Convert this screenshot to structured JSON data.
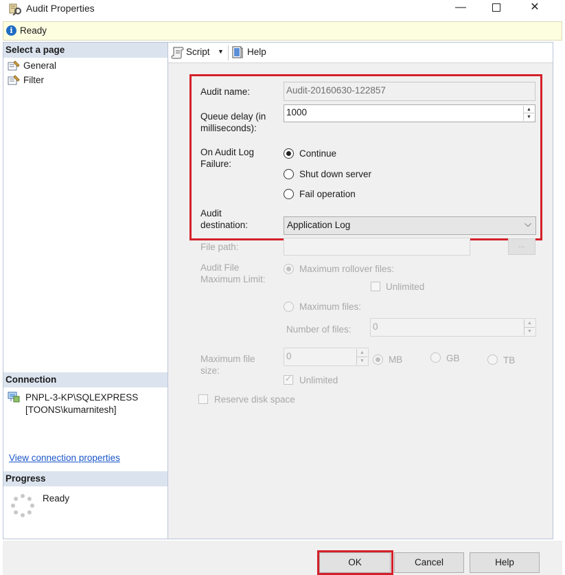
{
  "window": {
    "title": "Audit Properties",
    "minimize_glyph": "—",
    "close_glyph": "✕"
  },
  "status": {
    "icon": "info-icon",
    "text": "Ready"
  },
  "left_pane": {
    "select_page_header": "Select a page",
    "pages": [
      {
        "label": "General",
        "icon": "wrench-page-icon"
      },
      {
        "label": "Filter",
        "icon": "wrench-page-icon"
      }
    ],
    "connection_header": "Connection",
    "connection_server": "PNPL-3-KP\\SQLEXPRESS",
    "connection_user": "[TOONS\\kumarnitesh]",
    "view_connection_link": "View connection properties",
    "progress_header": "Progress",
    "progress_text": "Ready"
  },
  "toolbar": {
    "script_label": "Script",
    "help_label": "Help",
    "caret_glyph": "▼"
  },
  "form": {
    "audit_name_label": "Audit name:",
    "audit_name_value": "Audit-20160630-122857",
    "queue_delay_label_1": "Queue delay (in",
    "queue_delay_label_2": "milliseconds):",
    "queue_delay_value": "1000",
    "on_failure_label_1": "On Audit Log",
    "on_failure_label_2": "Failure:",
    "on_failure_options": [
      {
        "label": "Continue",
        "selected": true
      },
      {
        "label": "Shut down server",
        "selected": false
      },
      {
        "label": "Fail operation",
        "selected": false
      }
    ],
    "destination_label_1": "Audit",
    "destination_label_2": "destination:",
    "destination_value": "Application Log",
    "file_path_label": "File path:",
    "file_path_value": "",
    "browse_label": "...",
    "max_limit_label_1": "Audit File",
    "max_limit_label_2": "Maximum Limit:",
    "max_rollover_label": "Maximum rollover files:",
    "rollover_unlimited_label": "Unlimited",
    "max_files_label": "Maximum files:",
    "number_of_files_label": "Number of files:",
    "number_of_files_value": "0",
    "max_file_size_label_1": "Maximum file",
    "max_file_size_label_2": "size:",
    "max_file_size_value": "0",
    "size_units": [
      "MB",
      "GB",
      "TB"
    ],
    "size_unlimited_label": "Unlimited",
    "reserve_disk_label": "Reserve disk space"
  },
  "buttons": {
    "ok": "OK",
    "cancel": "Cancel",
    "help": "Help"
  },
  "colors": {
    "highlight": "#d4202a",
    "link": "#1a56c8",
    "status_bg": "#fdfde0",
    "section_header_bg": "#dbe3ee"
  }
}
